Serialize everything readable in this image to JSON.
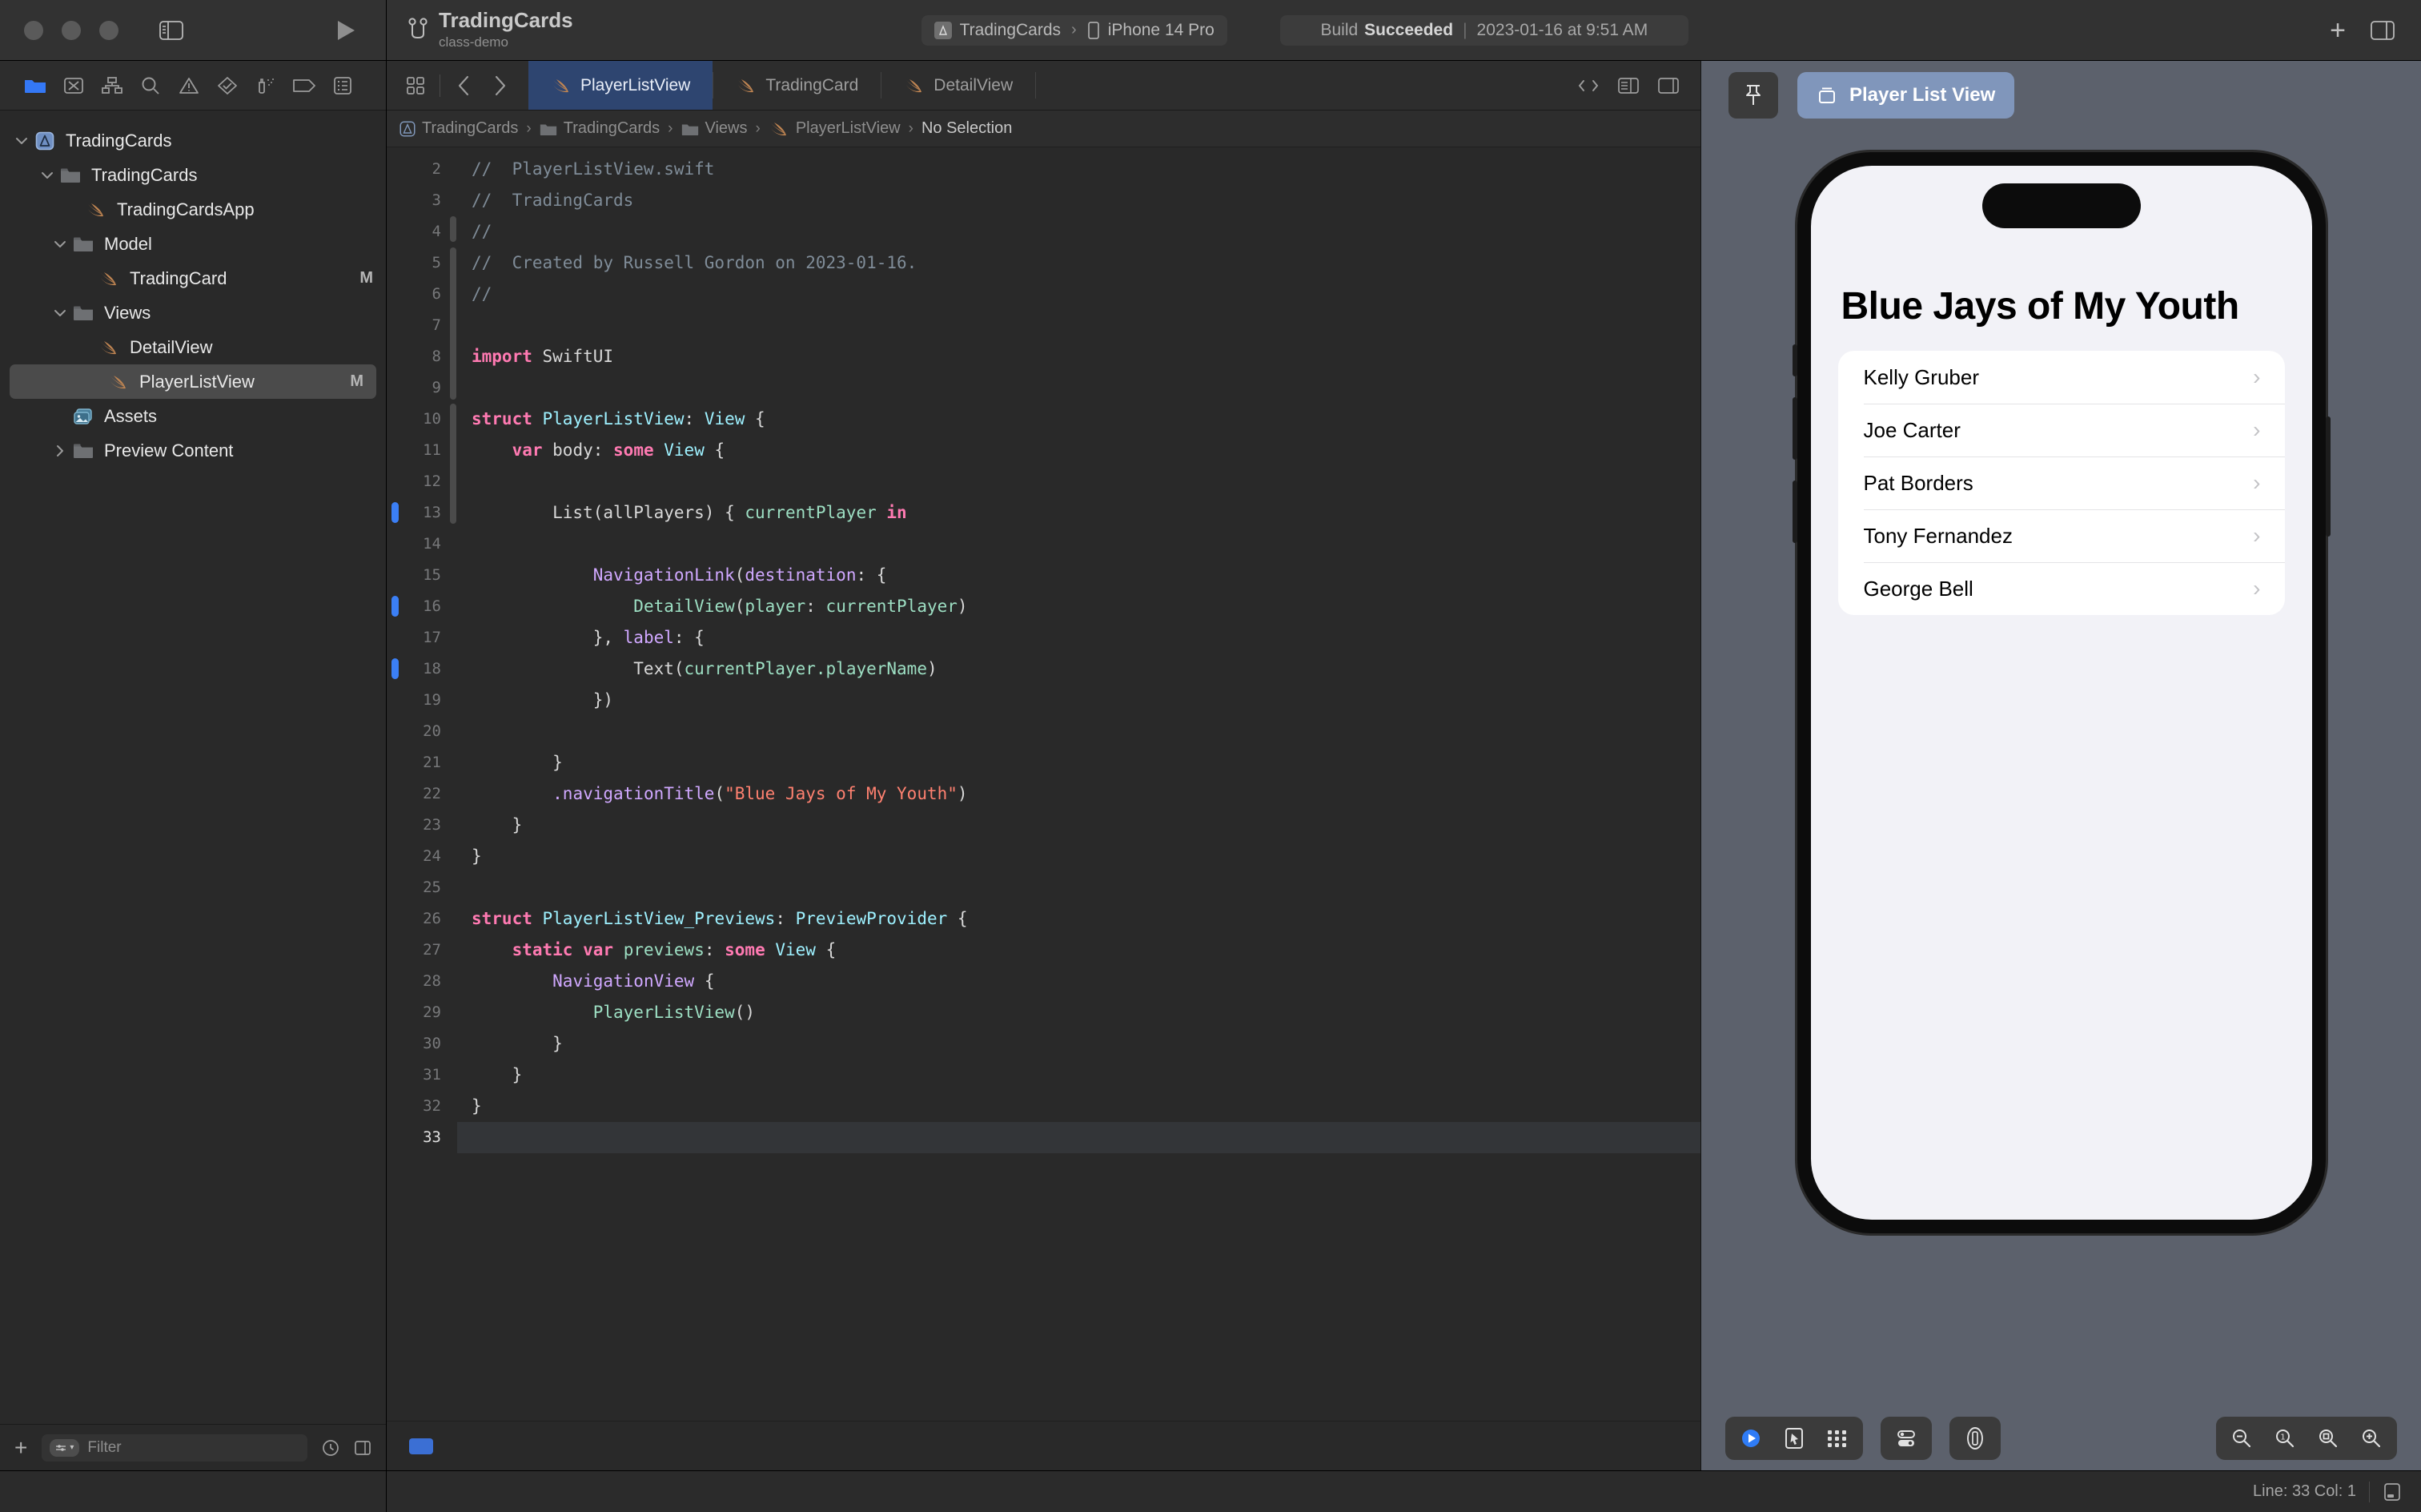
{
  "window": {
    "traffic_lights": [
      "close",
      "minimize",
      "zoom"
    ],
    "sidebar_toggle_icon": "sidebar-toggle-icon",
    "run_icon": "run-triangle-icon",
    "add_icon": "plus-icon",
    "inspector_toggle_icon": "inspector-toggle-icon"
  },
  "toolbar": {
    "project_title": "TradingCards",
    "project_branch": "class-demo",
    "branch_icon": "source-control-branch-icon",
    "scheme": {
      "target": "TradingCards",
      "separator": "›",
      "destination": "iPhone 14 Pro",
      "target_icon": "app-icon",
      "device_icon": "iphone-icon"
    },
    "build_status": {
      "prefix": "Build",
      "result": "Succeeded",
      "divider": "|",
      "timestamp": "2023-01-16 at 9:51 AM"
    }
  },
  "navigator": {
    "tabs": [
      {
        "name": "project-navigator",
        "icon": "folder-icon",
        "active": true
      },
      {
        "name": "source-control-navigator",
        "icon": "source-control-icon",
        "active": false
      },
      {
        "name": "symbol-navigator",
        "icon": "hierarchy-icon",
        "active": false
      },
      {
        "name": "find-navigator",
        "icon": "magnifier-icon",
        "active": false
      },
      {
        "name": "issue-navigator",
        "icon": "warning-triangle-icon",
        "active": false
      },
      {
        "name": "test-navigator",
        "icon": "diamond-check-icon",
        "active": false
      },
      {
        "name": "debug-navigator",
        "icon": "spray-icon",
        "active": false
      },
      {
        "name": "breakpoint-navigator",
        "icon": "breakpoint-icon",
        "active": false
      },
      {
        "name": "report-navigator",
        "icon": "report-list-icon",
        "active": false
      }
    ],
    "tree": [
      {
        "label": "TradingCards",
        "indent": 0,
        "icon": "xcode-project-icon",
        "twisty": "down",
        "badge": "",
        "selected": false
      },
      {
        "label": "TradingCards",
        "indent": 1,
        "icon": "folder-icon",
        "twisty": "down",
        "badge": "",
        "selected": false
      },
      {
        "label": "TradingCardsApp",
        "indent": 2,
        "icon": "swift-file-icon",
        "twisty": "",
        "badge": "",
        "selected": false
      },
      {
        "label": "Model",
        "indent": 1.5,
        "icon": "folder-icon",
        "twisty": "down",
        "badge": "",
        "selected": false
      },
      {
        "label": "TradingCard",
        "indent": 2.5,
        "icon": "swift-file-icon",
        "twisty": "",
        "badge": "M",
        "selected": false
      },
      {
        "label": "Views",
        "indent": 1.5,
        "icon": "folder-icon",
        "twisty": "down",
        "badge": "",
        "selected": false
      },
      {
        "label": "DetailView",
        "indent": 2.5,
        "icon": "swift-file-icon",
        "twisty": "",
        "badge": "",
        "selected": false
      },
      {
        "label": "PlayerListView",
        "indent": 2.5,
        "icon": "swift-file-icon",
        "twisty": "",
        "badge": "M",
        "selected": true
      },
      {
        "label": "Assets",
        "indent": 1.5,
        "icon": "assets-icon",
        "twisty": "",
        "badge": "",
        "selected": false
      },
      {
        "label": "Preview Content",
        "indent": 1.5,
        "icon": "folder-icon",
        "twisty": "right",
        "badge": "",
        "selected": false
      }
    ],
    "bottom": {
      "add_icon": "plus-icon",
      "filter_pill_icon": "filter-toggle-icon",
      "filter_placeholder": "Filter",
      "recent_icon": "clock-icon",
      "sourcecontrol_icon": "status-filter-icon"
    }
  },
  "editor": {
    "left_icons": [
      "grid-icon",
      "back-chevron-icon",
      "forward-chevron-icon"
    ],
    "tabs": [
      {
        "label": "PlayerListView",
        "icon": "swift-file-icon",
        "active": true
      },
      {
        "label": "TradingCard",
        "icon": "swift-file-icon",
        "active": false
      },
      {
        "label": "DetailView",
        "icon": "swift-file-icon",
        "active": false
      }
    ],
    "right_icons": [
      "code-review-icon",
      "editor-options-icon",
      "add-editor-icon"
    ],
    "breadcrumb": [
      {
        "label": "TradingCards",
        "icon": "xcode-project-icon"
      },
      {
        "label": "TradingCards",
        "icon": "folder-icon"
      },
      {
        "label": "Views",
        "icon": "folder-icon"
      },
      {
        "label": "PlayerListView",
        "icon": "swift-file-icon"
      },
      {
        "label": "No Selection",
        "icon": ""
      }
    ],
    "breadcrumb_separator": "›",
    "lines": [
      {
        "n": 2,
        "tokens": [
          {
            "t": "//  PlayerListView.swift",
            "c": "cm"
          }
        ]
      },
      {
        "n": 3,
        "tokens": [
          {
            "t": "//  TradingCards",
            "c": "cm"
          }
        ]
      },
      {
        "n": 4,
        "tokens": [
          {
            "t": "//",
            "c": "cm"
          }
        ]
      },
      {
        "n": 5,
        "tokens": [
          {
            "t": "//  Created by Russell Gordon on 2023-01-16.",
            "c": "cm"
          }
        ]
      },
      {
        "n": 6,
        "tokens": [
          {
            "t": "//",
            "c": "cm"
          }
        ]
      },
      {
        "n": 7,
        "tokens": []
      },
      {
        "n": 8,
        "tokens": [
          {
            "t": "import",
            "c": "kw"
          },
          {
            "t": " SwiftUI",
            "c": "pl"
          }
        ]
      },
      {
        "n": 9,
        "tokens": []
      },
      {
        "n": 10,
        "tokens": [
          {
            "t": "struct",
            "c": "kw"
          },
          {
            "t": " ",
            "c": "pl"
          },
          {
            "t": "PlayerListView",
            "c": "ty"
          },
          {
            "t": ": ",
            "c": "pl"
          },
          {
            "t": "View",
            "c": "ty"
          },
          {
            "t": " {",
            "c": "pl"
          }
        ]
      },
      {
        "n": 11,
        "tokens": [
          {
            "t": "    ",
            "c": "pl"
          },
          {
            "t": "var",
            "c": "kw"
          },
          {
            "t": " body",
            "c": "pl"
          },
          {
            "t": ": ",
            "c": "pl"
          },
          {
            "t": "some",
            "c": "kw"
          },
          {
            "t": " ",
            "c": "pl"
          },
          {
            "t": "View",
            "c": "ty"
          },
          {
            "t": " {",
            "c": "pl"
          }
        ]
      },
      {
        "n": 12,
        "tokens": []
      },
      {
        "n": 13,
        "tokens": [
          {
            "t": "        List(allPlayers) { ",
            "c": "pl"
          },
          {
            "t": "currentPlayer",
            "c": "pm"
          },
          {
            "t": " ",
            "c": "pl"
          },
          {
            "t": "in",
            "c": "kw"
          }
        ]
      },
      {
        "n": 14,
        "tokens": []
      },
      {
        "n": 15,
        "tokens": [
          {
            "t": "            ",
            "c": "pl"
          },
          {
            "t": "NavigationLink",
            "c": "pt"
          },
          {
            "t": "(",
            "c": "pl"
          },
          {
            "t": "destination",
            "c": "pt"
          },
          {
            "t": ": {",
            "c": "pl"
          }
        ]
      },
      {
        "n": 16,
        "tokens": [
          {
            "t": "                ",
            "c": "pl"
          },
          {
            "t": "DetailView",
            "c": "pm"
          },
          {
            "t": "(",
            "c": "pl"
          },
          {
            "t": "player",
            "c": "pm"
          },
          {
            "t": ": ",
            "c": "pl"
          },
          {
            "t": "currentPlayer",
            "c": "pm"
          },
          {
            "t": ")",
            "c": "pl"
          }
        ]
      },
      {
        "n": 17,
        "tokens": [
          {
            "t": "            }, ",
            "c": "pl"
          },
          {
            "t": "label",
            "c": "pt"
          },
          {
            "t": ": {",
            "c": "pl"
          }
        ]
      },
      {
        "n": 18,
        "tokens": [
          {
            "t": "                Text(",
            "c": "pl"
          },
          {
            "t": "currentPlayer",
            "c": "pm"
          },
          {
            "t": ".playerName",
            "c": "pm"
          },
          {
            "t": ")",
            "c": "pl"
          }
        ]
      },
      {
        "n": 19,
        "tokens": [
          {
            "t": "            })",
            "c": "pl"
          }
        ]
      },
      {
        "n": 20,
        "tokens": []
      },
      {
        "n": 21,
        "tokens": [
          {
            "t": "        }",
            "c": "pl"
          }
        ]
      },
      {
        "n": 22,
        "tokens": [
          {
            "t": "        ",
            "c": "pl"
          },
          {
            "t": ".navigationTitle",
            "c": "pt"
          },
          {
            "t": "(",
            "c": "pl"
          },
          {
            "t": "\"Blue Jays of My Youth\"",
            "c": "st"
          },
          {
            "t": ")",
            "c": "pl"
          }
        ]
      },
      {
        "n": 23,
        "tokens": [
          {
            "t": "    }",
            "c": "pl"
          }
        ]
      },
      {
        "n": 24,
        "tokens": [
          {
            "t": "}",
            "c": "pl"
          }
        ]
      },
      {
        "n": 25,
        "tokens": []
      },
      {
        "n": 26,
        "tokens": [
          {
            "t": "struct",
            "c": "kw"
          },
          {
            "t": " ",
            "c": "pl"
          },
          {
            "t": "PlayerListView_Previews",
            "c": "ty"
          },
          {
            "t": ": ",
            "c": "pl"
          },
          {
            "t": "PreviewProvider",
            "c": "ty"
          },
          {
            "t": " {",
            "c": "pl"
          }
        ]
      },
      {
        "n": 27,
        "tokens": [
          {
            "t": "    ",
            "c": "pl"
          },
          {
            "t": "static",
            "c": "kw"
          },
          {
            "t": " ",
            "c": "pl"
          },
          {
            "t": "var",
            "c": "kw"
          },
          {
            "t": " ",
            "c": "pl"
          },
          {
            "t": "previews",
            "c": "pm"
          },
          {
            "t": ": ",
            "c": "pl"
          },
          {
            "t": "some",
            "c": "kw"
          },
          {
            "t": " ",
            "c": "pl"
          },
          {
            "t": "View",
            "c": "ty"
          },
          {
            "t": " {",
            "c": "pl"
          }
        ]
      },
      {
        "n": 28,
        "tokens": [
          {
            "t": "        ",
            "c": "pl"
          },
          {
            "t": "NavigationView",
            "c": "pt"
          },
          {
            "t": " {",
            "c": "pl"
          }
        ]
      },
      {
        "n": 29,
        "tokens": [
          {
            "t": "            ",
            "c": "pl"
          },
          {
            "t": "PlayerListView",
            "c": "pm"
          },
          {
            "t": "()",
            "c": "pl"
          }
        ]
      },
      {
        "n": 30,
        "tokens": [
          {
            "t": "        }",
            "c": "pl"
          }
        ]
      },
      {
        "n": 31,
        "tokens": [
          {
            "t": "    }",
            "c": "pl"
          }
        ]
      },
      {
        "n": 32,
        "tokens": [
          {
            "t": "}",
            "c": "pl"
          }
        ]
      },
      {
        "n": 33,
        "tokens": []
      }
    ],
    "breakpoint_lines": [
      13,
      16,
      18
    ]
  },
  "canvas": {
    "pin_icon": "pin-icon",
    "preview_chip": {
      "label": "Player List View",
      "icon": "preview-device-icon"
    },
    "preview": {
      "nav_title": "Blue Jays of My Youth",
      "players": [
        "Kelly Gruber",
        "Joe Carter",
        "Pat Borders",
        "Tony Fernandez",
        "George Bell"
      ],
      "disclosure_glyph": "›"
    },
    "bottom_tools": {
      "left_group": [
        "live-preview-icon",
        "selectable-preview-icon",
        "variants-preview-icon"
      ],
      "middle_group": [
        "device-settings-icon"
      ],
      "device_group": [
        "device-orientation-icon"
      ],
      "zoom_group": [
        "zoom-out-icon",
        "zoom-actual-size-icon",
        "zoom-to-fit-icon",
        "zoom-in-icon"
      ]
    }
  },
  "statusbar": {
    "line_col": "Line: 33  Col: 1",
    "minimap_icon": "minimap-toggle-icon"
  }
}
